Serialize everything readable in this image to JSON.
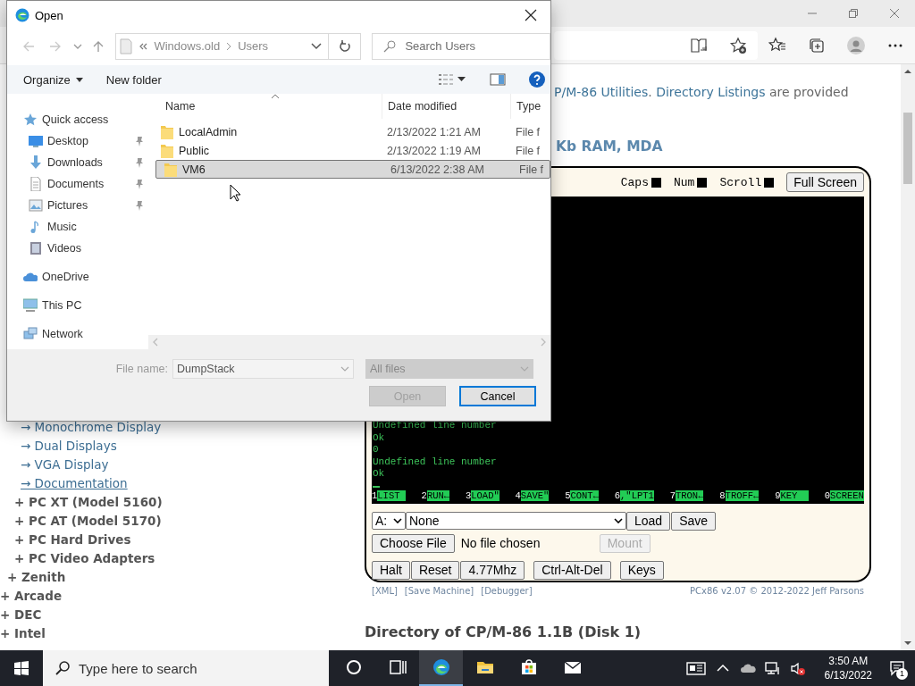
{
  "browser": {
    "intro": [
      {
        "text": "P/M-86 Utilities",
        "link": true
      },
      {
        "text": ". ",
        "link": false
      },
      {
        "text": "Directory Listings",
        "link": true
      },
      {
        "text": " are provided",
        "link": false
      }
    ],
    "heading": "Kb RAM, MDA",
    "nav": [
      {
        "children": [
          {
            "children": [
              {
                "children": [
                  {
                    "label": "→ Monochrome Display",
                    "kind": "arrow",
                    "hovered": false
                  },
                  {
                    "label": "→ Dual Displays",
                    "kind": "arrow",
                    "hovered": false
                  },
                  {
                    "label": "→ VGA Display",
                    "kind": "arrow",
                    "hovered": false
                  },
                  {
                    "label": "→ Documentation",
                    "kind": "arrow",
                    "hovered": true
                  }
                ]
              },
              {
                "label": "+ PC XT (Model 5160)",
                "kind": "plus",
                "hovered": false
              },
              {
                "label": "+ PC AT (Model 5170)",
                "kind": "plus",
                "hovered": false
              },
              {
                "label": "+ PC Hard Drives",
                "kind": "plus",
                "hovered": false
              },
              {
                "label": "+ PC Video Adapters",
                "kind": "plus",
                "hovered": false
              }
            ]
          },
          {
            "label": "+ Zenith",
            "kind": "plus",
            "hovered": false
          }
        ]
      },
      {
        "label": "+ Arcade",
        "kind": "plus",
        "hovered": false
      },
      {
        "label": "+ DEC",
        "kind": "plus",
        "hovered": false
      },
      {
        "label": "+ Intel",
        "kind": "plus",
        "hovered": false
      }
    ],
    "emulator": {
      "indicators": [
        {
          "label": "Caps",
          "on": false
        },
        {
          "label": "Num",
          "on": false
        },
        {
          "label": "Scroll",
          "on": false
        }
      ],
      "full_screen": "Full Screen",
      "screen_lines": [
        "Undefined line number",
        "Ok",
        "0",
        "Undefined line number",
        "Ok"
      ],
      "function_keys": [
        {
          "key": "1",
          "label": "LIST "
        },
        {
          "key": "2",
          "label": "RUN←"
        },
        {
          "key": "3",
          "label": "LOAD\""
        },
        {
          "key": "4",
          "label": "SAVE\""
        },
        {
          "key": "5",
          "label": "CONT←"
        },
        {
          "key": "6",
          "label": ",\"LPT1"
        },
        {
          "key": "7",
          "label": "TRON←"
        },
        {
          "key": "8",
          "label": "TROFF←"
        },
        {
          "key": "9",
          "label": "KEY  "
        },
        {
          "key": "0",
          "label": "SCREEN"
        }
      ],
      "drive": "A:",
      "disk": "None",
      "disk_buttons": [
        "Load",
        "Save"
      ],
      "choose_file": "Choose File",
      "file_status": "No file chosen",
      "mount": {
        "label": "Mount",
        "disabled": true
      },
      "controls": [
        "Halt",
        "Reset",
        "4.77Mhz",
        "Ctrl-Alt-Del",
        "Keys"
      ],
      "footer_links": [
        "[XML]",
        "[Save Machine]",
        "[Debugger]"
      ],
      "credit": "PCx86 v2.07 © 2012-2022 Jeff Parsons"
    },
    "section_heading": "Directory of CP/M-86 1.1B (Disk 1)"
  },
  "dialog": {
    "title": "Open",
    "path": [
      "Windows.old",
      "Users"
    ],
    "search": {
      "placeholder": "Search Users"
    },
    "toolbar": [
      "Organize",
      "New folder"
    ],
    "nav_pane": [
      {
        "label": "Quick access",
        "kind": "star",
        "pinned": false,
        "children": [
          {
            "label": "Desktop",
            "kind": "desktop",
            "pinned": true
          },
          {
            "label": "Downloads",
            "kind": "downloads",
            "pinned": true
          },
          {
            "label": "Documents",
            "kind": "documents",
            "pinned": true
          },
          {
            "label": "Pictures",
            "kind": "pictures",
            "pinned": true
          },
          {
            "label": "Music",
            "kind": "music",
            "pinned": false
          },
          {
            "label": "Videos",
            "kind": "videos",
            "pinned": false
          }
        ]
      },
      {
        "label": "OneDrive",
        "kind": "cloud",
        "pinned": false
      },
      {
        "label": "This PC",
        "kind": "pc",
        "pinned": false
      },
      {
        "label": "Network",
        "kind": "network",
        "pinned": false
      }
    ],
    "columns": [
      "Name",
      "Date modified",
      "Type"
    ],
    "rows": [
      {
        "name": "LocalAdmin",
        "date": "2/13/2022 1:21 AM",
        "type": "File f",
        "selected": false
      },
      {
        "name": "Public",
        "date": "2/13/2022 1:19 AM",
        "type": "File f",
        "selected": false
      },
      {
        "name": "VM6",
        "date": "6/13/2022 2:38 AM",
        "type": "File f",
        "selected": true
      }
    ],
    "file_name": {
      "label": "File name:",
      "value": "DumpStack"
    },
    "filter": "All files",
    "buttons": [
      {
        "label": "Open",
        "disabled": true,
        "focused": false
      },
      {
        "label": "Cancel",
        "disabled": false,
        "focused": true
      }
    ]
  },
  "taskbar": {
    "search": {
      "placeholder": "Type here to search"
    },
    "apps": [
      {
        "kind": "cortana",
        "active": false
      },
      {
        "kind": "taskview",
        "active": false
      },
      {
        "kind": "edge",
        "active": true
      },
      {
        "kind": "explorer",
        "active": false
      },
      {
        "kind": "store",
        "active": false
      },
      {
        "kind": "mail",
        "active": false
      }
    ],
    "time": "3:50 AM",
    "date": "6/13/2022",
    "notifications": "1"
  }
}
